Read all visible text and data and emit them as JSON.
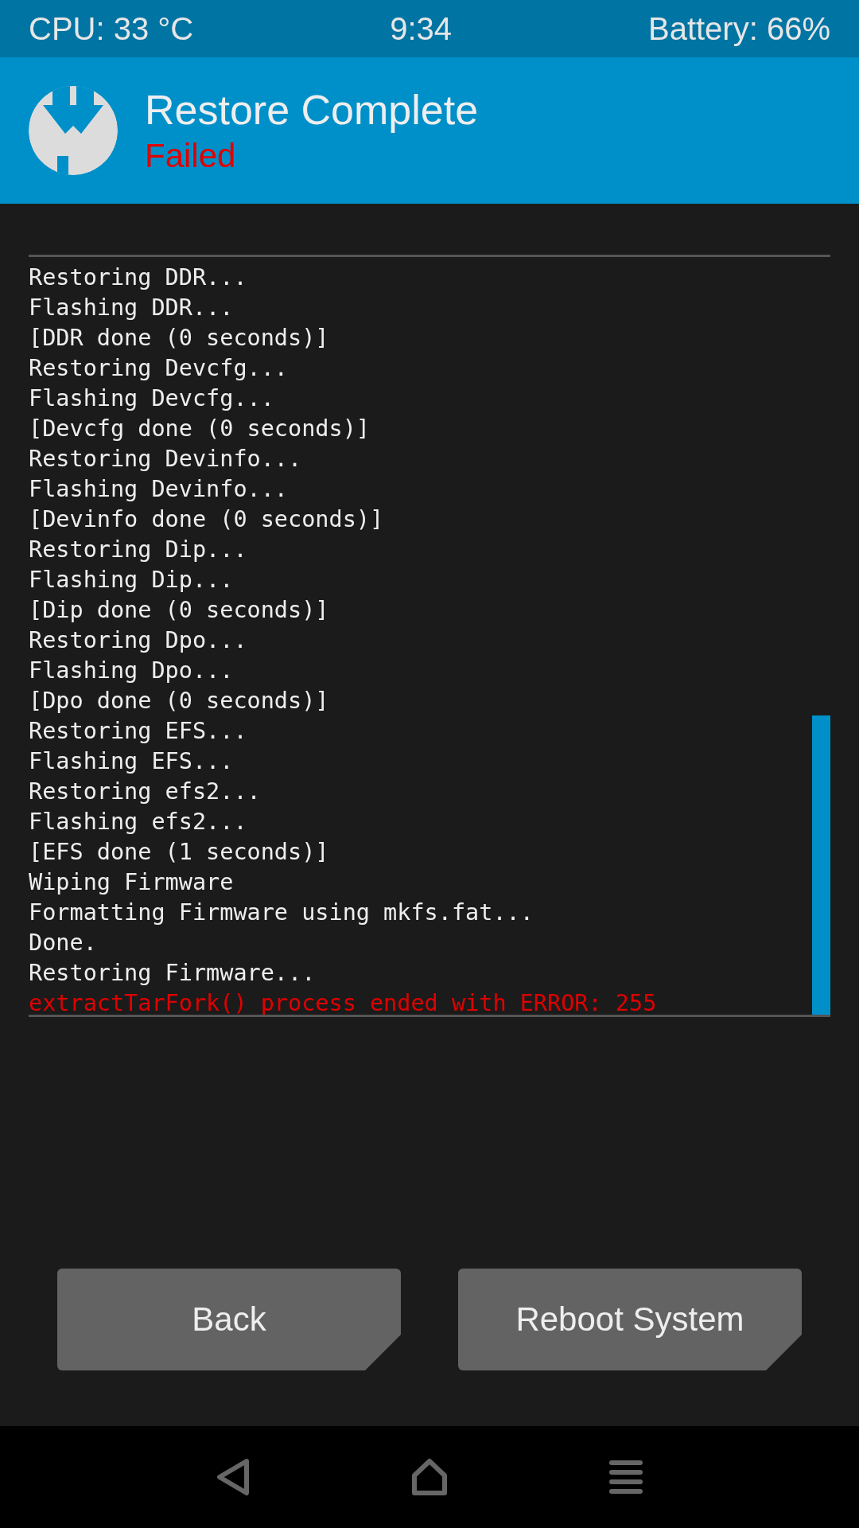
{
  "status_bar": {
    "cpu": "CPU: 33 °C",
    "time": "9:34",
    "battery": "Battery: 66%"
  },
  "header": {
    "title": "Restore Complete",
    "status": "Failed"
  },
  "log": [
    {
      "text": "Restoring DDR...",
      "kind": "info"
    },
    {
      "text": "Flashing DDR...",
      "kind": "info"
    },
    {
      "text": "[DDR done (0 seconds)]",
      "kind": "info"
    },
    {
      "text": "Restoring Devcfg...",
      "kind": "info"
    },
    {
      "text": "Flashing Devcfg...",
      "kind": "info"
    },
    {
      "text": "[Devcfg done (0 seconds)]",
      "kind": "info"
    },
    {
      "text": "Restoring Devinfo...",
      "kind": "info"
    },
    {
      "text": "Flashing Devinfo...",
      "kind": "info"
    },
    {
      "text": "[Devinfo done (0 seconds)]",
      "kind": "info"
    },
    {
      "text": "Restoring Dip...",
      "kind": "info"
    },
    {
      "text": "Flashing Dip...",
      "kind": "info"
    },
    {
      "text": "[Dip done (0 seconds)]",
      "kind": "info"
    },
    {
      "text": "Restoring Dpo...",
      "kind": "info"
    },
    {
      "text": "Flashing Dpo...",
      "kind": "info"
    },
    {
      "text": "[Dpo done (0 seconds)]",
      "kind": "info"
    },
    {
      "text": "Restoring EFS...",
      "kind": "info"
    },
    {
      "text": "Flashing EFS...",
      "kind": "info"
    },
    {
      "text": "Restoring efs2...",
      "kind": "info"
    },
    {
      "text": "Flashing efs2...",
      "kind": "info"
    },
    {
      "text": "[EFS done (1 seconds)]",
      "kind": "info"
    },
    {
      "text": "Wiping Firmware",
      "kind": "info"
    },
    {
      "text": "Formatting Firmware using mkfs.fat...",
      "kind": "info"
    },
    {
      "text": "Done.",
      "kind": "info"
    },
    {
      "text": "Restoring Firmware...",
      "kind": "info"
    },
    {
      "text": "extractTarFork() process ended with ERROR: 255",
      "kind": "error"
    }
  ],
  "buttons": [
    "Back",
    "Reboot System"
  ]
}
